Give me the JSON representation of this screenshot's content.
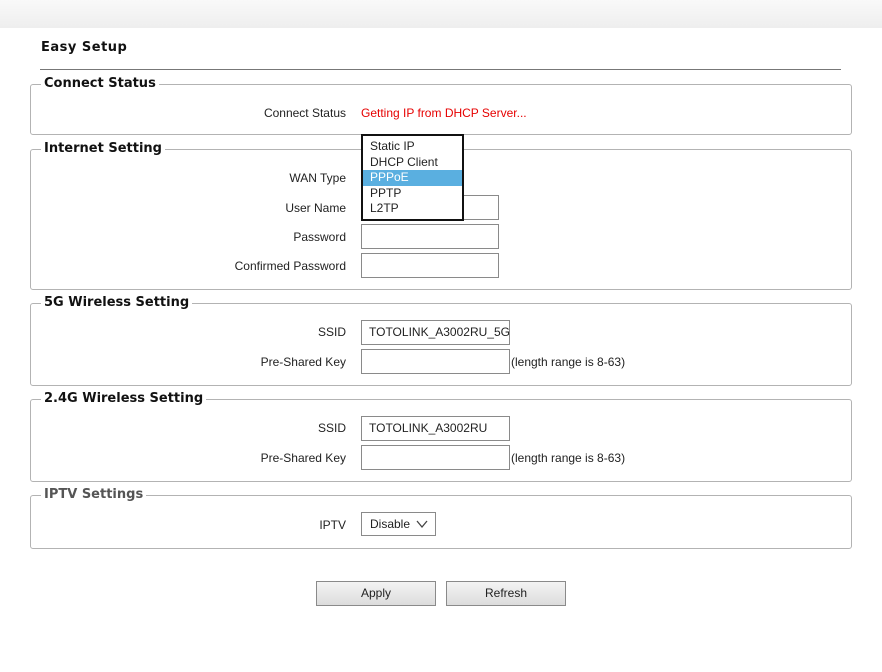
{
  "page": {
    "title": "Easy Setup"
  },
  "connect_status": {
    "legend": "Connect Status",
    "label": "Connect Status",
    "value": "Getting IP from DHCP Server...",
    "value_color": "#e60000"
  },
  "internet": {
    "legend": "Internet Setting",
    "wan_label": "WAN Type",
    "wan_options": [
      "Static IP",
      "DHCP Client",
      "PPPoE",
      "PPTP",
      "L2TP"
    ],
    "wan_selected": "PPPoE",
    "user_label": "User Name",
    "user_value": "",
    "password_label": "Password",
    "password_value": "",
    "confirm_label": "Confirmed Password",
    "confirm_value": ""
  },
  "wireless5g": {
    "legend": "5G Wireless Setting",
    "ssid_label": "SSID",
    "ssid_value": "TOTOLINK_A3002RU_5G",
    "psk_label": "Pre-Shared Key",
    "psk_value": "",
    "psk_hint": "(length range is 8-63)"
  },
  "wireless24g": {
    "legend": "2.4G Wireless Setting",
    "ssid_label": "SSID",
    "ssid_value": "TOTOLINK_A3002RU",
    "psk_label": "Pre-Shared Key",
    "psk_value": "",
    "psk_hint": "(length range is 8-63)"
  },
  "iptv": {
    "legend": "IPTV Settings",
    "label": "IPTV",
    "value": "Disable",
    "icon": "chevron-down-icon"
  },
  "buttons": {
    "apply": "Apply",
    "refresh": "Refresh"
  },
  "colors": {
    "selection": "#5aafe0",
    "status_red": "#e60000"
  }
}
